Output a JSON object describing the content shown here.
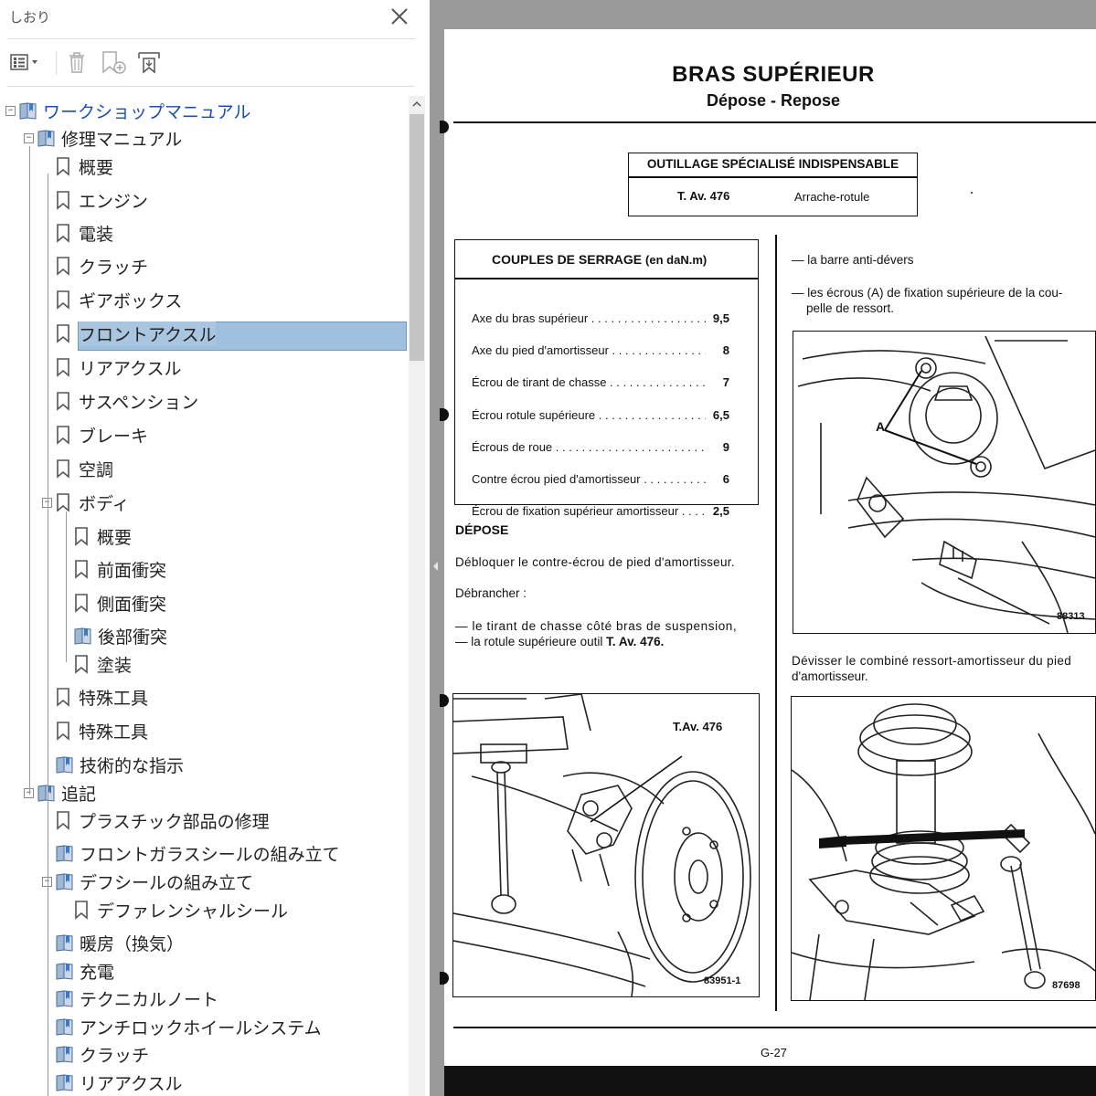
{
  "panel": {
    "title": "しおり",
    "toolbar": [
      "options-menu-icon",
      "delete-icon",
      "new-bookmark-icon",
      "expand-bookmark-icon"
    ]
  },
  "tree": [
    {
      "label": "ワークショップマニュアル",
      "level": 0,
      "icon": "book",
      "expander": "minus",
      "blue": true
    },
    {
      "label": "修理マニュアル",
      "level": 1,
      "icon": "book",
      "expander": "minus"
    },
    {
      "label": "概要",
      "level": 2,
      "icon": "bookmark"
    },
    {
      "label": "エンジン",
      "level": 2,
      "icon": "bookmark"
    },
    {
      "label": "電装",
      "level": 2,
      "icon": "bookmark"
    },
    {
      "label": "クラッチ",
      "level": 2,
      "icon": "bookmark"
    },
    {
      "label": "ギアボックス",
      "level": 2,
      "icon": "bookmark"
    },
    {
      "label": "フロントアクスル",
      "level": 2,
      "icon": "bookmark",
      "selected": true
    },
    {
      "label": "リアアクスル",
      "level": 2,
      "icon": "bookmark"
    },
    {
      "label": "サスペンション",
      "level": 2,
      "icon": "bookmark"
    },
    {
      "label": "ブレーキ",
      "level": 2,
      "icon": "bookmark"
    },
    {
      "label": "空調",
      "level": 2,
      "icon": "bookmark"
    },
    {
      "label": "ボディ",
      "level": 2,
      "icon": "bookmark",
      "expander": "minus"
    },
    {
      "label": "概要",
      "level": 3,
      "icon": "bookmark"
    },
    {
      "label": "前面衝突",
      "level": 3,
      "icon": "bookmark"
    },
    {
      "label": "側面衝突",
      "level": 3,
      "icon": "bookmark"
    },
    {
      "label": "後部衝突",
      "level": 3,
      "icon": "book"
    },
    {
      "label": "塗装",
      "level": 3,
      "icon": "bookmark"
    },
    {
      "label": "特殊工具",
      "level": 2,
      "icon": "bookmark"
    },
    {
      "label": "特殊工具",
      "level": 2,
      "icon": "bookmark"
    },
    {
      "label": "技術的な指示",
      "level": 2,
      "icon": "book"
    },
    {
      "label": "追記",
      "level": 1,
      "icon": "book",
      "expander": "minus"
    },
    {
      "label": "プラスチック部品の修理",
      "level": 2,
      "icon": "bookmark"
    },
    {
      "label": "フロントガラスシールの組み立て",
      "level": 2,
      "icon": "book"
    },
    {
      "label": "デフシールの組み立て",
      "level": 2,
      "icon": "book",
      "expander": "minus"
    },
    {
      "label": "デファレンシャルシール",
      "level": 3,
      "icon": "bookmark"
    },
    {
      "label": "暖房（換気）",
      "level": 2,
      "icon": "book"
    },
    {
      "label": "充電",
      "level": 2,
      "icon": "book"
    },
    {
      "label": "テクニカルノート",
      "level": 2,
      "icon": "book"
    },
    {
      "label": "アンチロックホイールシステム",
      "level": 2,
      "icon": "book"
    },
    {
      "label": "クラッチ",
      "level": 2,
      "icon": "book"
    },
    {
      "label": "リアアクスル",
      "level": 2,
      "icon": "book"
    }
  ],
  "page": {
    "title": "BRAS SUPÉRIEUR",
    "subtitle": "Dépose - Repose",
    "tools_box": {
      "header": "OUTILLAGE SPÉCIALISÉ INDISPENSABLE",
      "tool": "T. Av. 476",
      "tool_name": "Arrache-rotule"
    },
    "torque": {
      "header": "COUPLES DE SERRAGE",
      "unit": "(en daN.m)",
      "rows": [
        {
          "name": "Axe du bras supérieur",
          "value": "9,5"
        },
        {
          "name": "Axe du pied d'amortisseur",
          "value": "8"
        },
        {
          "name": "Écrou de tirant de chasse",
          "value": "7"
        },
        {
          "name": "Écrou rotule supérieure",
          "value": "6,5"
        },
        {
          "name": "Écrous de roue",
          "value": "9"
        },
        {
          "name": "Contre écrou pied d'amortisseur",
          "value": "6"
        },
        {
          "name": "Écrou de fixation supérieur amortisseur",
          "value": "2,5"
        }
      ]
    },
    "depose_heading": "DÉPOSE",
    "p1": "Débloquer le contre-écrou de pied d'amortisseur.",
    "p2": "Débrancher :",
    "p3a": "— le tirant de chasse côté bras de suspension,",
    "p3b_prefix": "— la rotule supérieure outil ",
    "p3b_tool": "T. Av. 476.",
    "r1": "— la barre anti-dévers",
    "r2a": "— les écrous (A) de fixation supérieure de la cou-",
    "r2b": "pelle de ressort.",
    "fig1_code": "88313",
    "fig1_label": "A",
    "r3a": "Dévisser le combiné ressort-amortisseur du pied",
    "r3b": "d'amortisseur.",
    "fig2_tool": "T.Av. 476",
    "fig2_code": "83951-1",
    "fig3_code": "87698",
    "page_number": "G-27"
  }
}
